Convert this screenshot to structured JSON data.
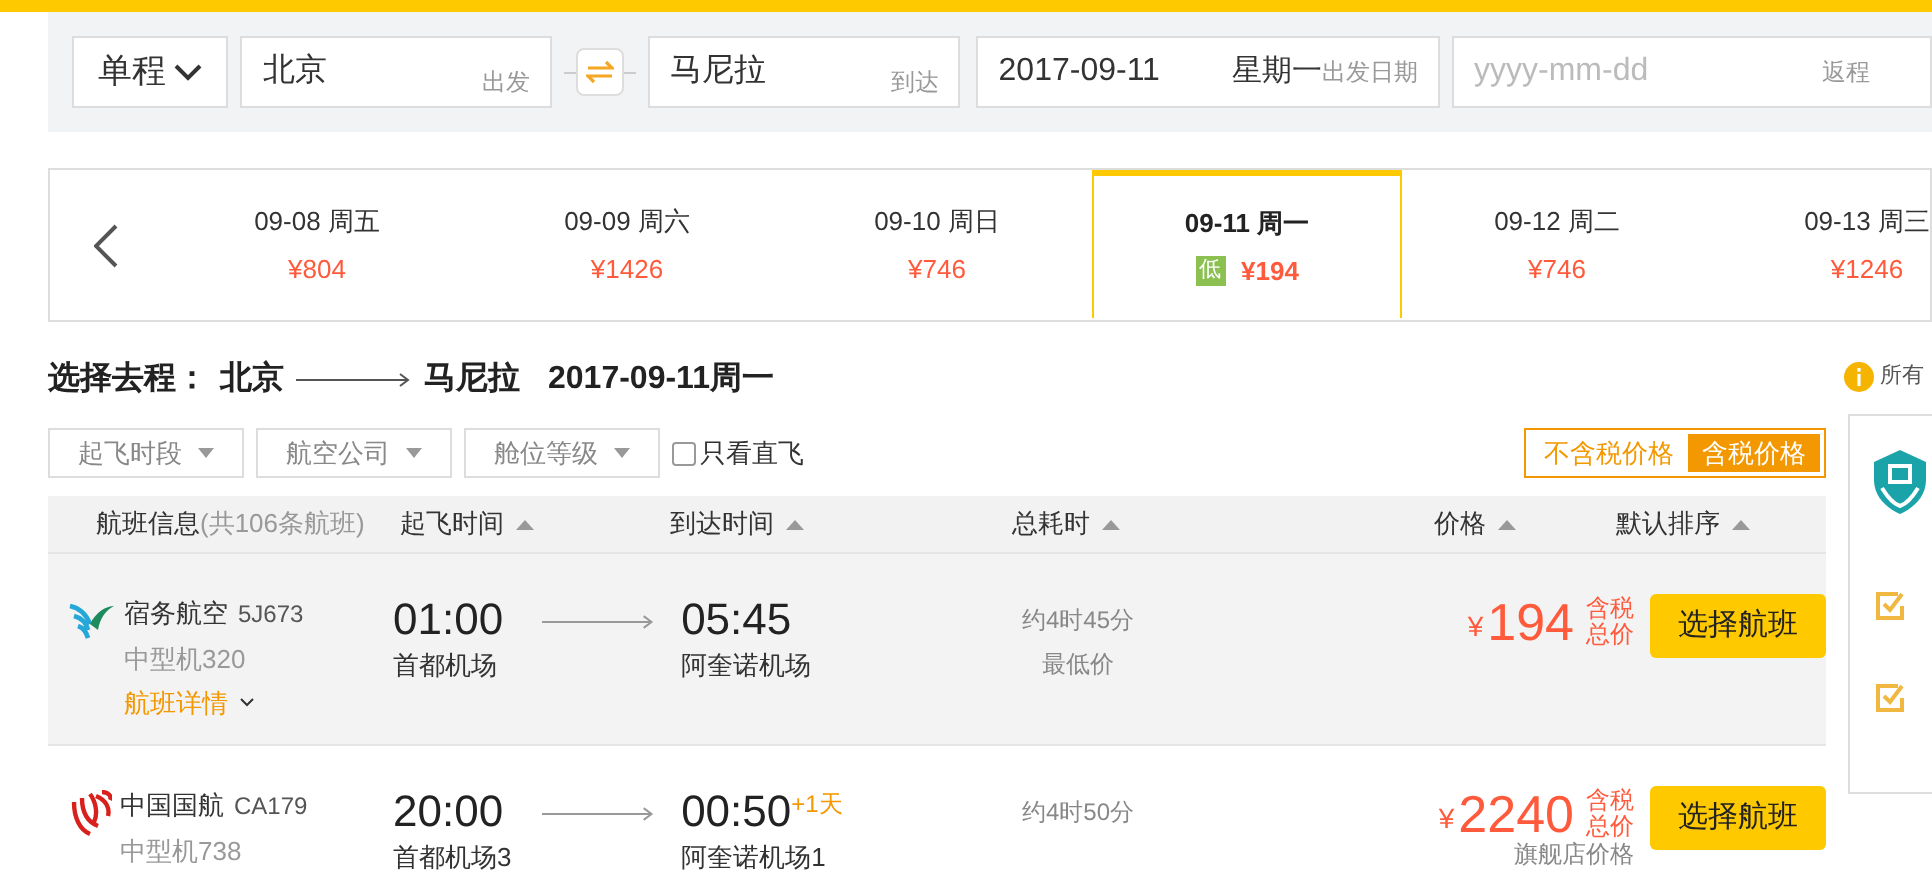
{
  "search": {
    "trip_type": "单程",
    "from": {
      "value": "北京",
      "label": "出发"
    },
    "to": {
      "value": "马尼拉",
      "label": "到达"
    },
    "depart": {
      "value": "2017-09-11",
      "weekday": "星期一",
      "label": "出发日期"
    },
    "return": {
      "placeholder": "yyyy-mm-dd",
      "label": "返程"
    }
  },
  "dates": [
    {
      "date": "09-08 周五",
      "price": "¥804",
      "selected": false
    },
    {
      "date": "09-09 周六",
      "price": "¥1426",
      "selected": false
    },
    {
      "date": "09-10 周日",
      "price": "¥746",
      "selected": false
    },
    {
      "date": "09-11 周一",
      "price": "¥194",
      "selected": true,
      "badge": "低"
    },
    {
      "date": "09-12 周二",
      "price": "¥746",
      "selected": false
    },
    {
      "date": "09-13 周三",
      "price": "¥1246",
      "selected": false
    }
  ],
  "route": {
    "label": "选择去程：",
    "from": "北京",
    "to": "马尼拉",
    "date": "2017-09-11周一"
  },
  "filters": [
    "起飞时段",
    "航空公司",
    "舱位等级"
  ],
  "direct_only": {
    "label": "只看直飞",
    "checked": false
  },
  "price_toggle": [
    {
      "label": "不含税价格",
      "selected": false
    },
    {
      "label": "含税价格",
      "selected": true
    }
  ],
  "columns": [
    {
      "label": "航班信息",
      "note": "(共106条航班)",
      "sortable": false
    },
    {
      "label": "起飞时间",
      "sortable": true
    },
    {
      "label": "到达时间",
      "sortable": true
    },
    {
      "label": "总耗时",
      "sortable": true
    },
    {
      "label": "价格",
      "sortable": true
    },
    {
      "label": "默认排序",
      "sortable": true
    }
  ],
  "flights": [
    {
      "kind": "swirl",
      "airline": "宿务航空",
      "flight_no": "5J673",
      "aircraft": "中型机320",
      "details": "航班详情",
      "depart_time": "01:00",
      "depart_airport": "首都机场",
      "arrive_time": "05:45",
      "arrive_airport": "阿奎诺机场",
      "duration": "约4时45分",
      "duration_note": "最低价",
      "currency": "¥",
      "price": "194",
      "tax_label": "含税",
      "total_label": "总价",
      "button": "选择航班",
      "highlighted": true
    },
    {
      "kind": "phoenix",
      "airline": "中国国航",
      "flight_no": "CA179",
      "aircraft": "中型机738",
      "depart_time": "20:00",
      "depart_airport": "首都机场3",
      "arrive_time": "00:50",
      "next_day": "+1天",
      "arrive_airport": "阿奎诺机场1",
      "duration": "约4时50分",
      "currency": "¥",
      "price": "2240",
      "tax_label": "含税",
      "total_label": "总价",
      "price_note": "旗舰店价格",
      "button": "选择航班",
      "highlighted": false
    }
  ],
  "sidebar": {
    "info_text": "所有"
  }
}
